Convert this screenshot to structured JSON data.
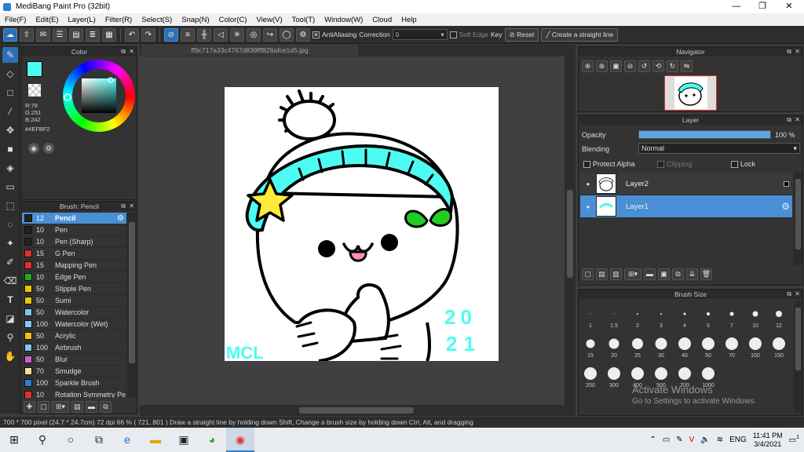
{
  "window": {
    "title": "MediBang Paint Pro (32bit)",
    "min": "—",
    "max": "❐",
    "close": "✕"
  },
  "menu": [
    "File(F)",
    "Edit(E)",
    "Layer(L)",
    "Filter(R)",
    "Select(S)",
    "Snap(N)",
    "Color(C)",
    "View(V)",
    "Tool(T)",
    "Window(W)",
    "Cloud",
    "Help"
  ],
  "toolbar": {
    "antialiasing_label": "AntiAliasing",
    "correction_label": "Correction",
    "correction_value": "0",
    "soft_edge_label": "Soft Edge",
    "key_label": "Key",
    "reset_label": "Reset",
    "straight_line_label": "Create a straight line"
  },
  "color_panel": {
    "title": "Color",
    "r": "R:78",
    "g": "G:251",
    "b": "B:242",
    "hex": "#4EFBF2",
    "current_color": "#4EFBF2"
  },
  "brush_panel": {
    "title": "Brush: Pencil",
    "items": [
      {
        "size": "12",
        "name": "Pencil",
        "color": "#222222",
        "selected": true
      },
      {
        "size": "10",
        "name": "Pen",
        "color": "#222222"
      },
      {
        "size": "10",
        "name": "Pen (Sharp)",
        "color": "#222222"
      },
      {
        "size": "15",
        "name": "G Pen",
        "color": "#e03030"
      },
      {
        "size": "15",
        "name": "Mapping Pen",
        "color": "#e03030"
      },
      {
        "size": "10",
        "name": "Edge Pen",
        "color": "#22aa22"
      },
      {
        "size": "50",
        "name": "Stipple Pen",
        "color": "#e8c800"
      },
      {
        "size": "50",
        "name": "Sumi",
        "color": "#e8c800"
      },
      {
        "size": "50",
        "name": "Watercolor",
        "color": "#7ec8f0"
      },
      {
        "size": "100",
        "name": "Watercolor (Wet)",
        "color": "#7ec8f0"
      },
      {
        "size": "50",
        "name": "Acrylic",
        "color": "#e8c800"
      },
      {
        "size": "100",
        "name": "Airbrush",
        "color": "#7ec8f0"
      },
      {
        "size": "50",
        "name": "Blur",
        "color": "#d060d0"
      },
      {
        "size": "70",
        "name": "Smudge",
        "color": "#f0e0a0"
      },
      {
        "size": "100",
        "name": "Sparkle Brush",
        "color": "#2a7fd4"
      },
      {
        "size": "10",
        "name": "Rotation Symmetry Pe",
        "color": "#e03030"
      }
    ]
  },
  "canvas": {
    "tab_title": "ff9c717a33c4767d839fff826afce1d5.jpg",
    "signature": "MCL",
    "year_top": "20",
    "year_bottom": "21"
  },
  "navigator": {
    "title": "Navigator"
  },
  "layer_panel": {
    "title": "Layer",
    "opacity_label": "Opacity",
    "opacity_value": "100 %",
    "opacity_fraction": 1.0,
    "blending_label": "Blending",
    "blending_value": "Normal",
    "protect_alpha_label": "Protect Alpha",
    "clipping_label": "Clipping",
    "lock_label": "Lock",
    "layers": [
      {
        "name": "Layer2",
        "selected": false
      },
      {
        "name": "Layer1",
        "selected": true
      }
    ]
  },
  "brush_size_panel": {
    "title": "Brush Size",
    "sizes": [
      "1",
      "1.5",
      "2",
      "3",
      "4",
      "5",
      "7",
      "10",
      "12",
      "15",
      "20",
      "25",
      "30",
      "40",
      "50",
      "70",
      "100",
      "150",
      "200",
      "300",
      "400",
      "500",
      "700",
      "1000"
    ]
  },
  "status_bar": {
    "text": "700 * 700 pixel  (24.7 * 24.7cm)  72 dpi  66 %  ( 721, 801 )  Draw a straight line by holding down Shift, Change a brush size by holding down Ctrl, Alt, and dragging"
  },
  "watermark": {
    "line1": "Activate Windows",
    "line2": "Go to Settings to activate Windows."
  },
  "taskbar": {
    "lang": "ENG",
    "time": "11:41 PM",
    "date": "3/4/2021",
    "notif_count": "1"
  }
}
